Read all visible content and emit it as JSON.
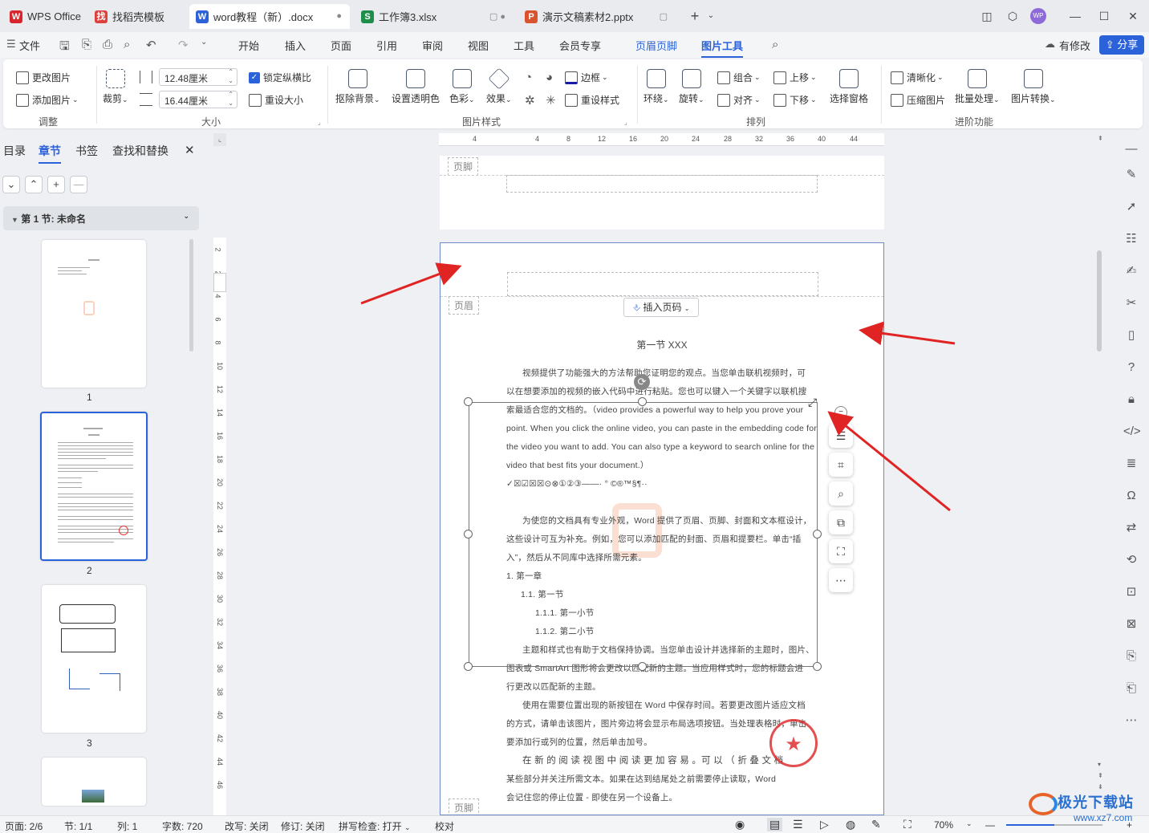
{
  "tabs": [
    {
      "label": "WPS Office",
      "icon": "W",
      "color": "#d9252e"
    },
    {
      "label": "找稻壳模板",
      "icon": "找",
      "color": "#e0403b"
    },
    {
      "label": "word教程（新）.docx",
      "icon": "W",
      "color": "#2b62d9",
      "state": "●"
    },
    {
      "label": "工作簿3.xlsx",
      "icon": "S",
      "color": "#1e8e4a",
      "state": "▢ ●"
    },
    {
      "label": "演示文稿素材2.pptx",
      "icon": "P",
      "color": "#d9532e",
      "state": "▢"
    }
  ],
  "menus": [
    "文件",
    "开始",
    "插入",
    "页面",
    "引用",
    "审阅",
    "视图",
    "工具",
    "会员专享",
    "页眉页脚",
    "图片工具"
  ],
  "menu_active": "图片工具",
  "menu_highlight": "页眉页脚",
  "account": {
    "modified": "有修改",
    "share": "分享",
    "avatar": "WP"
  },
  "ribbon": {
    "change_picture": "更改图片",
    "add_picture": "添加图片",
    "adjust_group": "调整",
    "crop": "裁剪",
    "width": "12.48厘米",
    "height": "16.44厘米",
    "lock_ratio": "锁定纵横比",
    "reset_size": "重设大小",
    "size_group": "大小",
    "remove_bg": "抠除背景",
    "set_transparent": "设置透明色",
    "color": "色彩",
    "effects": "效果",
    "border": "边框",
    "reset_style": "重设样式",
    "style_group": "图片样式",
    "wrap": "环绕",
    "rotate": "旋转",
    "group": "组合",
    "align": "对齐",
    "move_up": "上移",
    "move_down": "下移",
    "selection_pane": "选择窗格",
    "arrange_group": "排列",
    "sharpen": "清晰化",
    "compress": "压缩图片",
    "batch": "批量处理",
    "convert": "图片转换",
    "advanced_group": "进阶功能"
  },
  "nav": {
    "tabs": [
      "目录",
      "章节",
      "书签",
      "查找和替换"
    ],
    "active": "章节",
    "section": "第 1 节: 未命名",
    "pages": [
      "1",
      "2",
      "3"
    ]
  },
  "ruler": {
    "h": [
      "4",
      "4",
      "8",
      "12",
      "16",
      "20",
      "24",
      "28",
      "32",
      "36",
      "40",
      "44"
    ],
    "v": [
      "2",
      "2",
      "4",
      "6",
      "8",
      "10",
      "12",
      "14",
      "16",
      "18",
      "20",
      "22",
      "24",
      "26",
      "28",
      "30",
      "32",
      "34",
      "36",
      "38",
      "40",
      "42",
      "44",
      "46"
    ]
  },
  "document": {
    "footer_label": "页脚",
    "header_label": "页眉",
    "insert_page_number": "插入页码",
    "heading": "第一节 XXX",
    "lines": [
      "视频提供了功能强大的方法帮助您证明您的观点。当您单击联机视频时，可",
      "以在想要添加的视频的嵌入代码中进行粘贴。您也可以键入一个关键字以联机搜",
      "索最适合您的文档的。（video provides a powerful way to help you prove your",
      "point. When you click the online video, you can paste in the embedding code for",
      "the video you want to add. You can also type a keyword to search online for the",
      "video that best fits your document.）",
      "✓☒☑☒☒⊙⊗①②③——·  °  ©®™§¶··",
      "",
      "为使您的文档具有专业外观，Word 提供了页眉、页脚、封面和文本框设计，",
      "这些设计可互为补充。例如，您可以添加匹配的封面、页眉和提要栏。单击“插",
      "入”，然后从不同库中选择所需元素。",
      "1.  第一章",
      "1.1. 第一节",
      "1.1.1.  第一小节",
      "1.1.2.  第二小节",
      "主题和样式也有助于文档保持协调。当您单击设计并选择新的主题时，图片、",
      "图表或 SmartArt 图形将会更改以匹配新的主题。当应用样式时，您的标题会进",
      "行更改以匹配新的主题。",
      "使用在需要位置出现的新按钮在 Word 中保存时间。若要更改图片适应文档",
      "的方式，请单击该图片，图片旁边将会显示布局选项按钮。当处理表格时，单击",
      "要添加行或列的位置，然后单击加号。",
      "在 新 的 阅 读 视 图 中 阅 读 更 加 容 易 。可 以 （ 折 叠 文 档",
      "某些部分并关注所需文本。如果在达到结尾处之前需要停止读取，Word",
      "会记住您的停止位置 - 即使在另一个设备上。"
    ]
  },
  "status": {
    "page": "页面: 2/6",
    "section": "节: 1/1",
    "column": "列: 1",
    "words": "字数: 720",
    "overtype": "改写: 关闭",
    "revision": "修订: 关闭",
    "spellcheck": "拼写检查: 打开",
    "proofread": "校对",
    "zoom": "70%"
  },
  "watermark": "极光下载站",
  "watermark_url": "www.xz7.com",
  "colors": {
    "accent": "#2b62d9",
    "arrow": "#e02424"
  }
}
